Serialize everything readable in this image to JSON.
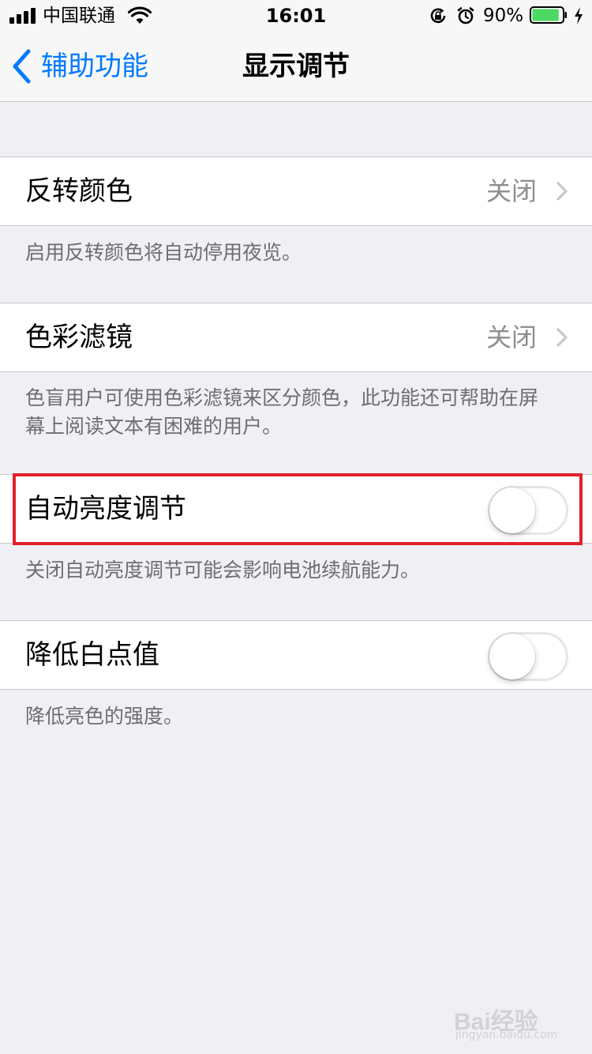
{
  "status_bar": {
    "carrier": "中国联通",
    "time": "16:01",
    "battery_percent": "90%",
    "battery_level": 0.9,
    "battery_color": "#4cd964"
  },
  "nav": {
    "back_label": "辅助功能",
    "title": "显示调节",
    "accent_color": "#007aff"
  },
  "sections": [
    {
      "label": "反转颜色",
      "value": "关闭",
      "footer": "启用反转颜色将自动停用夜览。"
    },
    {
      "label": "色彩滤镜",
      "value": "关闭",
      "footer_line1": "色盲用户可使用色彩滤镜来区分颜色，此功能还可帮助在屏",
      "footer_line2": "幕上阅读文本有困难的用户。"
    },
    {
      "label": "自动亮度调节",
      "toggle_on": false,
      "footer": "关闭自动亮度调节可能会影响电池续航能力。"
    },
    {
      "label": "降低白点值",
      "toggle_on": false,
      "footer": "降低亮色的强度。"
    }
  ],
  "highlight_color": "#e0222b",
  "watermark": {
    "brand": "Bai经验",
    "url": "jingyan.baidu.com"
  }
}
